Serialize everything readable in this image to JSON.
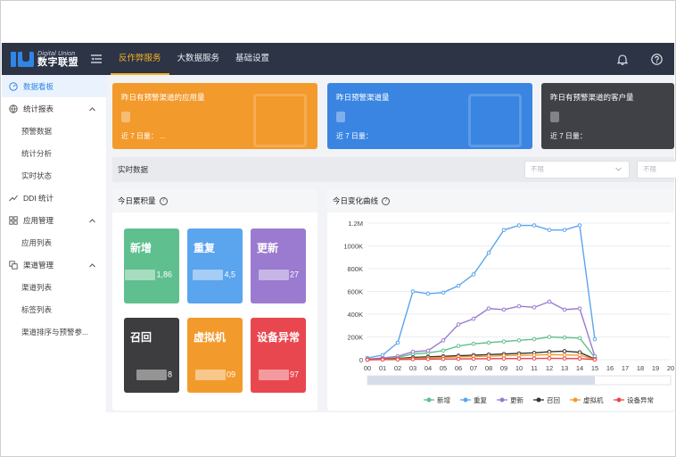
{
  "app": {
    "logo_en": "Digital Union",
    "logo_cn": "数字联盟"
  },
  "topnav": {
    "items": [
      {
        "label": "反作弊服务",
        "active": true
      },
      {
        "label": "大数据服务",
        "active": false
      },
      {
        "label": "基础设置",
        "active": false
      }
    ]
  },
  "sidebar": {
    "dashboard": "数据看板",
    "stats": {
      "label": "统计报表",
      "children": [
        "预警数据",
        "统计分析",
        "实时状态"
      ]
    },
    "ddi": "DDI 统计",
    "apps": {
      "label": "应用管理",
      "children": [
        "应用列表"
      ]
    },
    "channels": {
      "label": "渠道管理",
      "children": [
        "渠道列表",
        "标签列表",
        "渠道排序与预警参..."
      ]
    }
  },
  "cards": [
    {
      "label": "昨日有预警渠道的应用量",
      "sub": "近 7 日量：  ...",
      "color": "#f39a2c"
    },
    {
      "label": "昨日预警渠道量",
      "sub": "近 7 日量：",
      "color": "#3a85e2"
    },
    {
      "label": "昨日有预警渠道的客户量",
      "sub": "近 7 日量：",
      "color": "#3f4147"
    }
  ],
  "realtime": {
    "label": "实时数据",
    "select1": "不限",
    "select2": "不限"
  },
  "cumulative": {
    "title": "今日累积量",
    "tiles": [
      {
        "name": "新增",
        "value": "1,86",
        "color": "#5fbf8f"
      },
      {
        "name": "重复",
        "value": "4,5",
        "color": "#5ba4ee"
      },
      {
        "name": "更新",
        "value": "27",
        "color": "#9a7bcf"
      },
      {
        "name": "召回",
        "value": "8",
        "color": "#3d3d3f"
      },
      {
        "name": "虚拟机",
        "value": "09",
        "color": "#f39a2c"
      },
      {
        "name": "设备异常",
        "value": "97",
        "color": "#e9474f"
      }
    ]
  },
  "chart_data": {
    "type": "line",
    "title": "今日变化曲线",
    "x": [
      "00",
      "01",
      "02",
      "03",
      "04",
      "05",
      "06",
      "07",
      "08",
      "09",
      "10",
      "11",
      "12",
      "13",
      "14",
      "15",
      "16",
      "17",
      "18",
      "19",
      "20"
    ],
    "y_ticks": [
      "0",
      "200K",
      "400K",
      "600K",
      "800K",
      "1000K",
      "1.2M"
    ],
    "ylim": [
      0,
      1200000
    ],
    "grid": true,
    "legend_position": "bottom",
    "series": [
      {
        "name": "新增",
        "color": "#5fbf8f",
        "values": [
          5000,
          10000,
          20000,
          50000,
          60000,
          80000,
          120000,
          140000,
          150000,
          160000,
          170000,
          180000,
          200000,
          195000,
          190000,
          20000
        ]
      },
      {
        "name": "重复",
        "color": "#5ba4ee",
        "values": [
          15000,
          40000,
          150000,
          600000,
          580000,
          590000,
          650000,
          750000,
          940000,
          1140000,
          1180000,
          1180000,
          1140000,
          1140000,
          1180000,
          180000
        ]
      },
      {
        "name": "更新",
        "color": "#9a7bcf",
        "values": [
          5000,
          15000,
          30000,
          70000,
          80000,
          170000,
          310000,
          360000,
          450000,
          440000,
          470000,
          460000,
          510000,
          440000,
          450000,
          30000
        ]
      },
      {
        "name": "召回",
        "color": "#333333",
        "values": [
          0,
          5000,
          10000,
          20000,
          25000,
          30000,
          35000,
          40000,
          45000,
          50000,
          55000,
          60000,
          70000,
          75000,
          65000,
          5000
        ]
      },
      {
        "name": "虚拟机",
        "color": "#f39a2c",
        "values": [
          0,
          3000,
          6000,
          10000,
          15000,
          20000,
          25000,
          28000,
          30000,
          35000,
          38000,
          40000,
          45000,
          42000,
          40000,
          3000
        ]
      },
      {
        "name": "设备异常",
        "color": "#e9474f",
        "values": [
          0,
          1000,
          2000,
          4000,
          5000,
          6000,
          7000,
          8000,
          9000,
          10000,
          10000,
          11000,
          12000,
          11000,
          10000,
          1000
        ]
      }
    ]
  }
}
